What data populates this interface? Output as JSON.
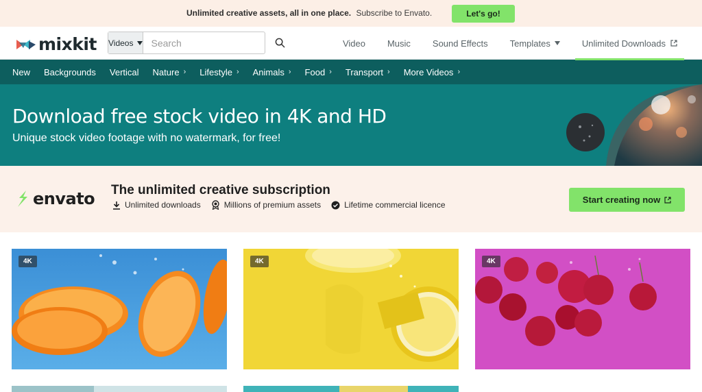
{
  "promo": {
    "headline": "Unlimited creative assets, all in one place.",
    "link": "Subscribe to Envato.",
    "cta": "Let's go!"
  },
  "header": {
    "logo": "mixkit",
    "search": {
      "category": "Videos",
      "placeholder": "Search"
    },
    "nav": [
      {
        "label": "Video"
      },
      {
        "label": "Music"
      },
      {
        "label": "Sound Effects"
      },
      {
        "label": "Templates"
      },
      {
        "label": "Unlimited Downloads"
      }
    ]
  },
  "categories": [
    {
      "label": "New"
    },
    {
      "label": "Backgrounds"
    },
    {
      "label": "Vertical"
    },
    {
      "label": "Nature"
    },
    {
      "label": "Lifestyle"
    },
    {
      "label": "Animals"
    },
    {
      "label": "Food"
    },
    {
      "label": "Transport"
    },
    {
      "label": "More Videos"
    }
  ],
  "hero": {
    "title": "Download free stock video in 4K and HD",
    "subtitle": "Unique stock video footage with no watermark, for free!"
  },
  "envato": {
    "logo": "envato",
    "title": "The unlimited creative subscription",
    "features": [
      {
        "label": "Unlimited downloads",
        "icon": "download-icon"
      },
      {
        "label": "Millions of premium assets",
        "icon": "award-icon"
      },
      {
        "label": "Lifetime commercial licence",
        "icon": "check-badge-icon"
      }
    ],
    "cta": "Start creating now"
  },
  "videos": [
    {
      "badge": "4K",
      "subject": "orange slices in water"
    },
    {
      "badge": "4K",
      "subject": "lemon slices on yellow"
    },
    {
      "badge": "4K",
      "subject": "cherries on pink"
    }
  ],
  "colors": {
    "accent_green": "#82e36a",
    "nav_teal_dark": "#0d5e5e",
    "hero_teal": "#0e7f7f",
    "promo_bg": "#fcefe6"
  }
}
